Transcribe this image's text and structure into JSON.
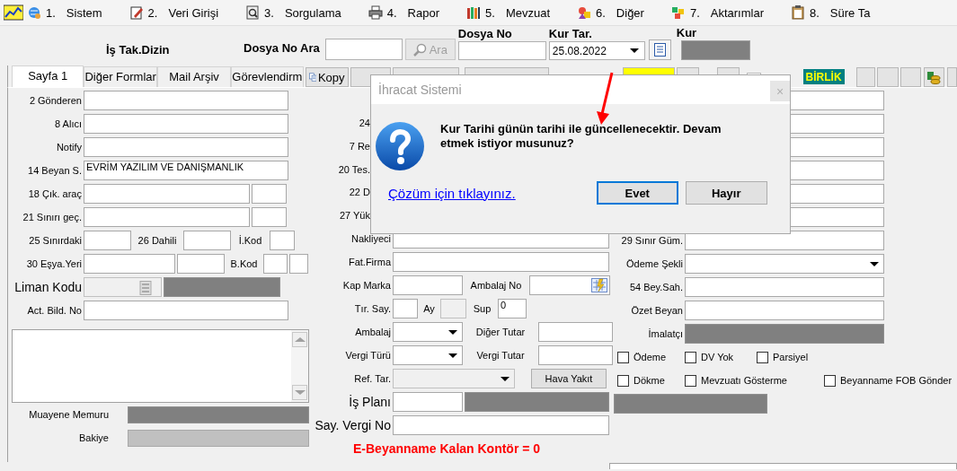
{
  "menu": [
    {
      "number": "1.",
      "label": "Sistem"
    },
    {
      "number": "2.",
      "label": "Veri Girişi"
    },
    {
      "number": "3.",
      "label": "Sorgulama"
    },
    {
      "number": "4.",
      "label": "Rapor"
    },
    {
      "number": "5.",
      "label": "Mevzuat"
    },
    {
      "number": "6.",
      "label": "Diğer"
    },
    {
      "number": "7.",
      "label": "Aktarımlar"
    },
    {
      "number": "8.",
      "label": "Süre Ta"
    }
  ],
  "header": {
    "title": "İş Tak.Dizin",
    "search_label": "Dosya No Ara",
    "search_button": {
      "label": "Ara",
      "disabled": true
    },
    "file_no_label": "Dosya No",
    "date_label": "Kur Tar.",
    "date_value": "25.08.2022",
    "rate_label": "Kur"
  },
  "tabs": [
    {
      "label": "Sayfa 1",
      "selected": true
    },
    {
      "label": "Diğer Formlar",
      "selected": false
    },
    {
      "label": "Mail Arşiv",
      "selected": false
    },
    {
      "label": "Görevlendirm",
      "selected": false
    }
  ],
  "toolbar": {
    "copy_button": "Kopy",
    "badge": "BİRLİK"
  },
  "columns": [
    {
      "rows": [
        {
          "kind": "field",
          "label": "2 Gönderen",
          "items": [
            {
              "kind": "input",
              "disabled": false
            }
          ]
        },
        {
          "kind": "field",
          "label": "8 Alıcı",
          "items": [
            {
              "kind": "input",
              "disabled": false
            }
          ]
        },
        {
          "kind": "field",
          "label": "Notify",
          "items": [
            {
              "kind": "input",
              "disabled": false
            }
          ]
        },
        {
          "kind": "field",
          "label": "14 Beyan S.",
          "items": [
            {
              "kind": "input",
              "disabled": false,
              "value": "EVRİM YAZILIM VE DANIŞMANLIK"
            }
          ]
        },
        {
          "kind": "field",
          "label": "18 Çık. araç",
          "items": [
            {
              "kind": "input",
              "disabled": false
            },
            {
              "kind": "input",
              "disabled": false
            }
          ]
        },
        {
          "kind": "field",
          "label": "21 Sınırı geç.",
          "items": [
            {
              "kind": "input",
              "disabled": false
            },
            {
              "kind": "input",
              "disabled": false
            }
          ]
        },
        {
          "kind": "field",
          "label": "25 Sınırdaki",
          "items": [
            {
              "kind": "input",
              "disabled": false
            },
            {
              "kind": "text",
              "text": "26 Dahili"
            },
            {
              "kind": "input",
              "disabled": false
            },
            {
              "kind": "text",
              "text": "İ.Kod"
            },
            {
              "kind": "input",
              "disabled": false
            }
          ]
        },
        {
          "kind": "field",
          "label": "30 Eşya.Yeri",
          "items": [
            {
              "kind": "input",
              "disabled": false
            },
            {
              "kind": "input",
              "disabled": false
            },
            {
              "kind": "text",
              "text": "B.Kod"
            },
            {
              "kind": "input",
              "disabled": false
            },
            {
              "kind": "input",
              "disabled": false
            }
          ]
        },
        {
          "kind": "large",
          "label": "Liman Kodu",
          "items": [
            {
              "kind": "lookup",
              "disabled": true
            },
            {
              "kind": "shaded"
            }
          ]
        },
        {
          "kind": "field",
          "label": "Act. Bild. No",
          "items": [
            {
              "kind": "input",
              "disabled": false
            }
          ]
        },
        {
          "kind": "memo",
          "items": [
            {
              "kind": "memo"
            }
          ]
        },
        {
          "kind": "footer",
          "label": "Muayene Memuru",
          "items": [
            {
              "kind": "shaded"
            }
          ]
        },
        {
          "kind": "footer",
          "label": "Bakiye",
          "items": [
            {
              "kind": "readonly"
            }
          ]
        }
      ]
    },
    {
      "rows": [
        {
          "kind": "covered",
          "label": "24"
        },
        {
          "kind": "covered",
          "label": "7 Re"
        },
        {
          "kind": "covered",
          "label": "20 Tes."
        },
        {
          "kind": "covered",
          "label": "22 D"
        },
        {
          "kind": "covered",
          "label": "27 Yük"
        },
        {
          "kind": "field",
          "label": "Nakliyeci",
          "items": [
            {
              "kind": "input",
              "disabled": false
            }
          ]
        },
        {
          "kind": "field",
          "label": "Fat.Firma",
          "items": [
            {
              "kind": "input",
              "disabled": false
            }
          ]
        },
        {
          "kind": "field",
          "label": "Kap Marka",
          "items": [
            {
              "kind": "input",
              "disabled": false
            },
            {
              "kind": "text",
              "text": "Ambalaj No"
            },
            {
              "kind": "picker"
            }
          ]
        },
        {
          "kind": "field",
          "label": "Tır. Say.",
          "items": [
            {
              "kind": "input",
              "disabled": false
            },
            {
              "kind": "text",
              "text": "Ay"
            },
            {
              "kind": "input",
              "disabled": true
            },
            {
              "kind": "text",
              "text": "Sup"
            },
            {
              "kind": "input",
              "disabled": false,
              "value": "0"
            }
          ]
        },
        {
          "kind": "field",
          "label": "Ambalaj",
          "items": [
            {
              "kind": "combo",
              "disabled": false
            },
            {
              "kind": "text",
              "text": "Diğer Tutar"
            },
            {
              "kind": "input",
              "disabled": false
            }
          ]
        },
        {
          "kind": "field",
          "label": "Vergi Türü",
          "items": [
            {
              "kind": "combo",
              "disabled": false
            },
            {
              "kind": "text",
              "text": "Vergi Tutar"
            },
            {
              "kind": "input",
              "disabled": false
            }
          ]
        },
        {
          "kind": "field",
          "label": "Ref. Tar.",
          "items": [
            {
              "kind": "combo",
              "disabled": true
            },
            {
              "kind": "button",
              "label": "Hava Yakıt"
            }
          ]
        },
        {
          "kind": "large",
          "label": "İş Planı",
          "items": [
            {
              "kind": "input",
              "disabled": false
            },
            {
              "kind": "shaded"
            }
          ]
        },
        {
          "kind": "large",
          "label": "Say. Vergi No",
          "items": [
            {
              "kind": "input",
              "disabled": false
            }
          ]
        },
        {
          "kind": "note",
          "text": "E-Beyanname Kalan Kontör = 0"
        }
      ]
    },
    {
      "rows": [
        {
          "kind": "field",
          "items": [
            {
              "kind": "input",
              "disabled": false
            }
          ]
        },
        {
          "kind": "field",
          "items": [
            {
              "kind": "input",
              "disabled": false
            }
          ]
        },
        {
          "kind": "field",
          "items": [
            {
              "kind": "input",
              "disabled": false
            }
          ]
        },
        {
          "kind": "field",
          "items": [
            {
              "kind": "input",
              "disabled": false
            }
          ]
        },
        {
          "kind": "field",
          "items": [
            {
              "kind": "input",
              "disabled": false
            }
          ]
        },
        {
          "kind": "field",
          "items": [
            {
              "kind": "input",
              "disabled": false
            }
          ]
        },
        {
          "kind": "field",
          "label": "29 Sınır Güm.",
          "items": [
            {
              "kind": "input",
              "disabled": false
            }
          ]
        },
        {
          "kind": "field",
          "label": "Ödeme Şekli",
          "items": [
            {
              "kind": "combo",
              "disabled": false
            }
          ]
        },
        {
          "kind": "field",
          "label": "54 Bey.Sah.",
          "items": [
            {
              "kind": "input",
              "disabled": false
            }
          ]
        },
        {
          "kind": "field",
          "label": "Özet Beyan",
          "items": [
            {
              "kind": "input",
              "disabled": false
            }
          ]
        },
        {
          "kind": "field",
          "label": "İmalatçı",
          "items": [
            {
              "kind": "shaded"
            }
          ]
        },
        {
          "kind": "checks",
          "items": [
            {
              "kind": "checkbox",
              "label": "Ödeme",
              "checked": false
            },
            {
              "kind": "checkbox",
              "label": "DV Yok",
              "checked": false
            },
            {
              "kind": "checkbox",
              "label": "Parsiyel",
              "checked": false
            }
          ]
        },
        {
          "kind": "checks",
          "items": [
            {
              "kind": "checkbox",
              "label": "Dökme",
              "checked": false
            },
            {
              "kind": "checkbox",
              "label": "Mevzuatı Gösterme",
              "checked": false
            },
            {
              "kind": "checkbox",
              "label": "Beyanname FOB Gönder",
              "checked": false
            }
          ]
        },
        {
          "kind": "plain",
          "items": [
            {
              "kind": "shaded"
            }
          ]
        }
      ]
    }
  ],
  "dialog": {
    "title": "İhracat Sistemi",
    "close": "×",
    "message": "Kur Tarihi günün tarihi ile güncellenecektir. Devam etmek istiyor musunuz?",
    "link": "Çözüm için tıklayınız.",
    "buttons": [
      {
        "label": "Evet",
        "selected": true
      },
      {
        "label": "Hayır",
        "selected": false
      }
    ]
  }
}
